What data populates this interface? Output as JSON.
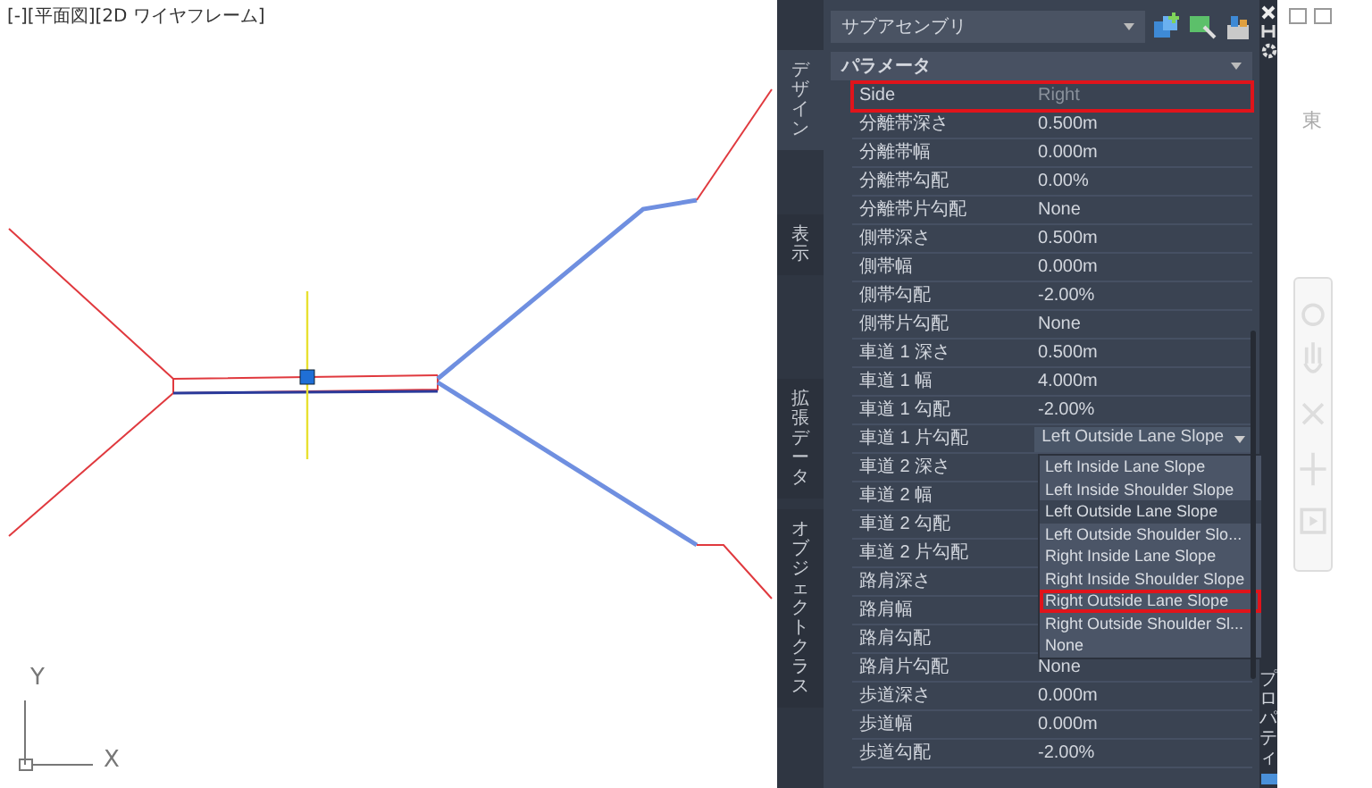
{
  "viewport": {
    "title": "[-][平面図][2D ワイヤフレーム]",
    "axis_labels": [
      "Y",
      "X"
    ]
  },
  "compass": {
    "label": "東"
  },
  "palette": {
    "tabs": [
      {
        "label": "デザイン",
        "selected": true
      },
      {
        "label": "表示",
        "selected": false
      },
      {
        "label": "拡張データ",
        "selected": false
      },
      {
        "label": "オブジェクトクラス",
        "selected": false
      }
    ],
    "combo": {
      "value": "サブアセンブリ"
    },
    "section": {
      "title": "パラメータ",
      "expanded": true
    },
    "rows": [
      {
        "label": "Side",
        "value": "Right",
        "kind": "readonly",
        "highlighted": true
      },
      {
        "label": "分離帯深さ",
        "value": "0.500m",
        "kind": "text",
        "highlighted": false
      },
      {
        "label": "分離帯幅",
        "value": "0.000m",
        "kind": "text",
        "highlighted": false
      },
      {
        "label": "分離帯勾配",
        "value": "0.00%",
        "kind": "text",
        "highlighted": false
      },
      {
        "label": "分離帯片勾配",
        "value": "None",
        "kind": "text",
        "highlighted": false
      },
      {
        "label": "側帯深さ",
        "value": "0.500m",
        "kind": "text",
        "highlighted": false
      },
      {
        "label": "側帯幅",
        "value": "0.000m",
        "kind": "text",
        "highlighted": false
      },
      {
        "label": "側帯勾配",
        "value": "-2.00%",
        "kind": "text",
        "highlighted": false
      },
      {
        "label": "側帯片勾配",
        "value": "None",
        "kind": "text",
        "highlighted": false
      },
      {
        "label": "車道 1 深さ",
        "value": "0.500m",
        "kind": "text",
        "highlighted": false
      },
      {
        "label": "車道 1 幅",
        "value": "4.000m",
        "kind": "text",
        "highlighted": false
      },
      {
        "label": "車道 1 勾配",
        "value": "-2.00%",
        "kind": "text",
        "highlighted": false
      },
      {
        "label": "車道 1 片勾配",
        "value": "Left Outside Lane Slope",
        "kind": "dropdown",
        "highlighted": false
      },
      {
        "label": "車道 2 深さ",
        "highlighted": false
      },
      {
        "label": "車道 2 幅",
        "highlighted": false
      },
      {
        "label": "車道 2 勾配",
        "highlighted": false
      },
      {
        "label": "車道 2 片勾配",
        "highlighted": false
      },
      {
        "label": "路肩深さ",
        "highlighted": false
      },
      {
        "label": "路肩幅",
        "highlighted": false
      },
      {
        "label": "路肩勾配",
        "highlighted": false
      },
      {
        "label": "路肩片勾配",
        "value": "None",
        "kind": "text",
        "highlighted": false
      },
      {
        "label": "歩道深さ",
        "value": "0.000m",
        "kind": "text",
        "highlighted": false
      },
      {
        "label": "歩道幅",
        "value": "0.000m",
        "kind": "text",
        "highlighted": false
      },
      {
        "label": "歩道勾配",
        "value": "-2.00%",
        "kind": "text",
        "highlighted": false
      }
    ],
    "dropdown_options": [
      {
        "label": "Left Inside Lane Slope",
        "selected": false,
        "highlighted": false
      },
      {
        "label": "Left Inside Shoulder Slope",
        "selected": false,
        "highlighted": false
      },
      {
        "label": "Left Outside Lane Slope",
        "selected": true,
        "highlighted": false
      },
      {
        "label": "Left Outside Shoulder Slo...",
        "selected": false,
        "highlighted": false
      },
      {
        "label": "Right Inside Lane Slope",
        "selected": false,
        "highlighted": false
      },
      {
        "label": "Right Inside Shoulder Slope",
        "selected": false,
        "highlighted": false
      },
      {
        "label": "Right Outside Lane Slope",
        "selected": false,
        "highlighted": true
      },
      {
        "label": "Right Outside Shoulder Sl...",
        "selected": false,
        "highlighted": false
      },
      {
        "label": "None",
        "selected": false,
        "highlighted": false
      }
    ],
    "side_tab": {
      "label": "プロパティ"
    }
  }
}
